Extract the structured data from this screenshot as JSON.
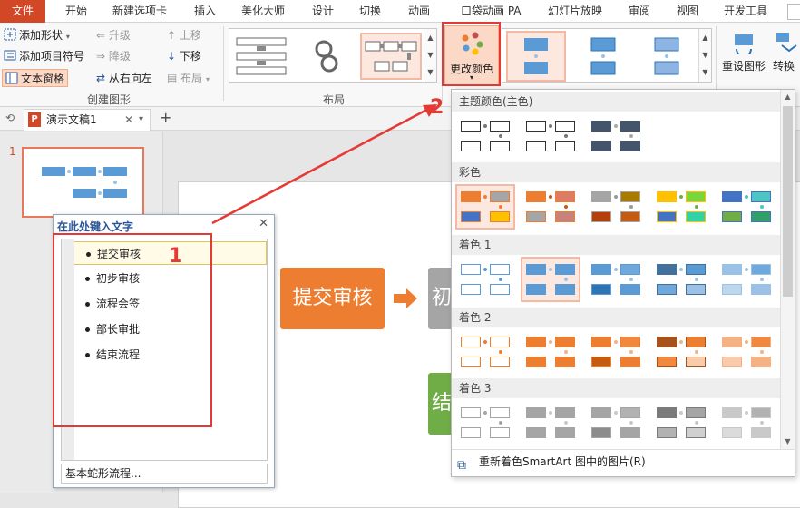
{
  "menu": {
    "file": "文件",
    "items": [
      "开始",
      "新建选项卡",
      "插入",
      "美化大师",
      "设计",
      "切换",
      "动画",
      "口袋动画 PA",
      "幻灯片放映",
      "审阅",
      "视图",
      "开发工具"
    ]
  },
  "ribbon": {
    "add_shape": "添加形状",
    "add_bullet": "添加项目符号",
    "text_pane": "文本窗格",
    "promote": "升级",
    "demote": "降级",
    "right_to_left": "从右向左",
    "move_up": "上移",
    "move_down": "下移",
    "layout_btn": "布局",
    "group_create": "创建图形",
    "group_layout": "布局",
    "change_colors": "更改颜色",
    "reset_graphic": "重设图形",
    "convert": "转换"
  },
  "doc_tab": {
    "title": "演示文稿1",
    "add": "+"
  },
  "thumb_number": "1",
  "text_pane": {
    "title": "在此处键入文字",
    "items": [
      "提交审核",
      "初步审核",
      "流程会签",
      "部长审批",
      "结束流程"
    ],
    "footer": "基本蛇形流程..."
  },
  "slide": {
    "shape1": "提交审核",
    "shape2_partial": "初",
    "shape3_partial": "结"
  },
  "annotations": {
    "one": "1",
    "two": "2"
  },
  "color_panel": {
    "sections": [
      "主题颜色(主色)",
      "彩色",
      "着色 1",
      "着色 2",
      "着色 3"
    ],
    "footer": "重新着色SmartArt 图中的图片(R)"
  },
  "colors": {
    "orange": "#ed7d31",
    "blue": "#5b9bd5",
    "gray": "#a5a5a5",
    "green": "#70ad47",
    "accent_red": "#e53935",
    "file_red": "#d24726"
  }
}
